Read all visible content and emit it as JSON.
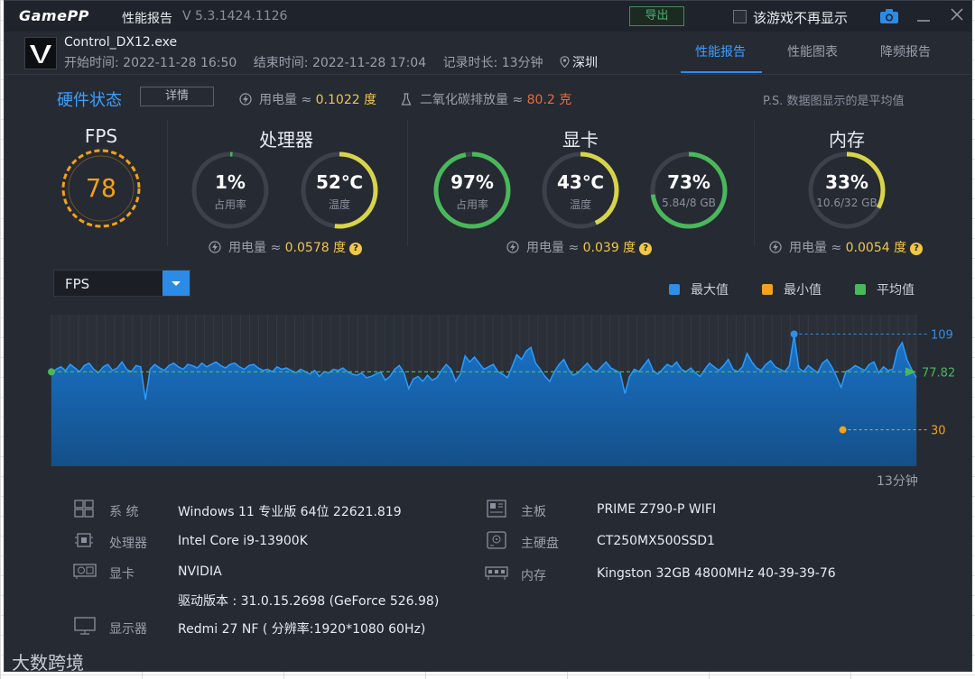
{
  "titlebar": {
    "logo": "GamePP",
    "title": "性能报告",
    "version": "V 5.3.1424.1126",
    "export_label": "导出",
    "no_show_label": "该游戏不再显示"
  },
  "header": {
    "exe": "Control_DX12.exe",
    "start": "开始时间: 2022-11-28 16:50",
    "end": "结束时间: 2022-11-28 17:04",
    "duration": "记录时长: 13分钟",
    "location": "深圳",
    "tabs": [
      {
        "label": "性能报告",
        "active": true
      },
      {
        "label": "性能图表",
        "active": false
      },
      {
        "label": "降频报告",
        "active": false
      }
    ]
  },
  "hardware": {
    "title": "硬件状态",
    "detail_label": "详情",
    "power_label": "用电量 ≈",
    "power_value": "0.1022 度",
    "co2_label": "二氧化碳排放量 ≈",
    "co2_value": "80.2 克",
    "note": "P.S. 数据图显示的是平均值"
  },
  "sections": {
    "fps": {
      "title": "FPS",
      "value": "78",
      "fill": 1.0
    },
    "cpu": {
      "title": "处理器",
      "usage": {
        "value": "1%",
        "label": "占用率",
        "fill": 0.01
      },
      "temp": {
        "value": "52℃",
        "label": "温度",
        "fill": 0.52
      },
      "power_label": "用电量 ≈",
      "power_value": "0.0578 度"
    },
    "gpu": {
      "title": "显卡",
      "usage": {
        "value": "97%",
        "label": "占用率",
        "fill": 0.97
      },
      "temp": {
        "value": "43℃",
        "label": "温度",
        "fill": 0.43
      },
      "mem": {
        "value": "73%",
        "label": "5.84/8 GB",
        "fill": 0.73
      },
      "power_label": "用电量 ≈",
      "power_value": "0.039 度"
    },
    "ram": {
      "title": "内存",
      "usage": {
        "value": "33%",
        "label": "10.6/32 GB",
        "fill": 0.33
      },
      "power_label": "用电量 ≈",
      "power_value": "0.0054 度"
    }
  },
  "colors": {
    "accent": "#2f8ee8",
    "fps_ring": "#f2a21b",
    "ring_green": "#49b85a",
    "ring_yellow": "#d8d44a",
    "ring_track": "#3c414b",
    "max": "#2f8ee8",
    "min": "#f2a21b",
    "avg": "#49b85a"
  },
  "chart_select": {
    "label": "FPS"
  },
  "legend": {
    "max": "最大值",
    "min": "最小值",
    "avg": "平均值"
  },
  "chart_data": {
    "type": "area",
    "series_label": "FPS",
    "x_end_label": "13分钟",
    "max": 109,
    "avg": 77.82,
    "min": 30,
    "ylim": [
      0,
      125
    ],
    "values": [
      76,
      80,
      82,
      79,
      84,
      81,
      78,
      83,
      85,
      80,
      77,
      82,
      84,
      79,
      81,
      86,
      80,
      78,
      83,
      82,
      55,
      80,
      84,
      81,
      79,
      83,
      85,
      82,
      80,
      84,
      83,
      81,
      85,
      82,
      84,
      86,
      83,
      81,
      84,
      85,
      82,
      80,
      83,
      84,
      81,
      79,
      80,
      78,
      82,
      80,
      81,
      79,
      77,
      80,
      78,
      76,
      79,
      74,
      78,
      77,
      80,
      79,
      81,
      78,
      76,
      75,
      77,
      73,
      74,
      76,
      78,
      71,
      74,
      80,
      83,
      77,
      64,
      72,
      74,
      70,
      75,
      71,
      73,
      79,
      84,
      80,
      70,
      76,
      91,
      86,
      90,
      85,
      80,
      82,
      84,
      78,
      76,
      73,
      82,
      92,
      88,
      95,
      98,
      85,
      80,
      74,
      70,
      78,
      84,
      88,
      80,
      75,
      77,
      81,
      85,
      80,
      78,
      82,
      86,
      81,
      79,
      77,
      60,
      74,
      80,
      78,
      83,
      88,
      79,
      76,
      80,
      84,
      82,
      86,
      80,
      78,
      81,
      77,
      74,
      80,
      85,
      82,
      79,
      83,
      88,
      80,
      78,
      82,
      93,
      86,
      81,
      79,
      84,
      87,
      82,
      80,
      78,
      83,
      108,
      81,
      78,
      83,
      80,
      77,
      85,
      88,
      82,
      74,
      65,
      78,
      80,
      83,
      81,
      79,
      84,
      86,
      77,
      82,
      79,
      80,
      96,
      102,
      88,
      80,
      73
    ],
    "x_points": 180
  },
  "system": {
    "left": [
      {
        "icon": "windows-icon",
        "key": "系  统",
        "value": "Windows 11 专业版 64位 22621.819"
      },
      {
        "icon": "cpu-icon",
        "key": "处理器",
        "value": "Intel Core i9-13900K"
      },
      {
        "icon": "gpu-icon",
        "key": "显卡",
        "value": "NVIDIA"
      },
      {
        "icon": "",
        "key": "",
        "value": "驱动版本 : 31.0.15.2698 (GeForce 526.98)"
      },
      {
        "icon": "monitor-icon",
        "key": "显示器",
        "value": "Redmi 27 NF ( 分辨率:1920*1080 60Hz)"
      }
    ],
    "right": [
      {
        "icon": "motherboard-icon",
        "key": "主板",
        "value": "PRIME Z790-P WIFI"
      },
      {
        "icon": "disk-icon",
        "key": "主硬盘",
        "value": "CT250MX500SSD1"
      },
      {
        "icon": "ram-icon",
        "key": "内存",
        "value": "Kingston 32GB 4800MHz 40-39-39-76"
      }
    ]
  },
  "watermark": "大数跨境"
}
